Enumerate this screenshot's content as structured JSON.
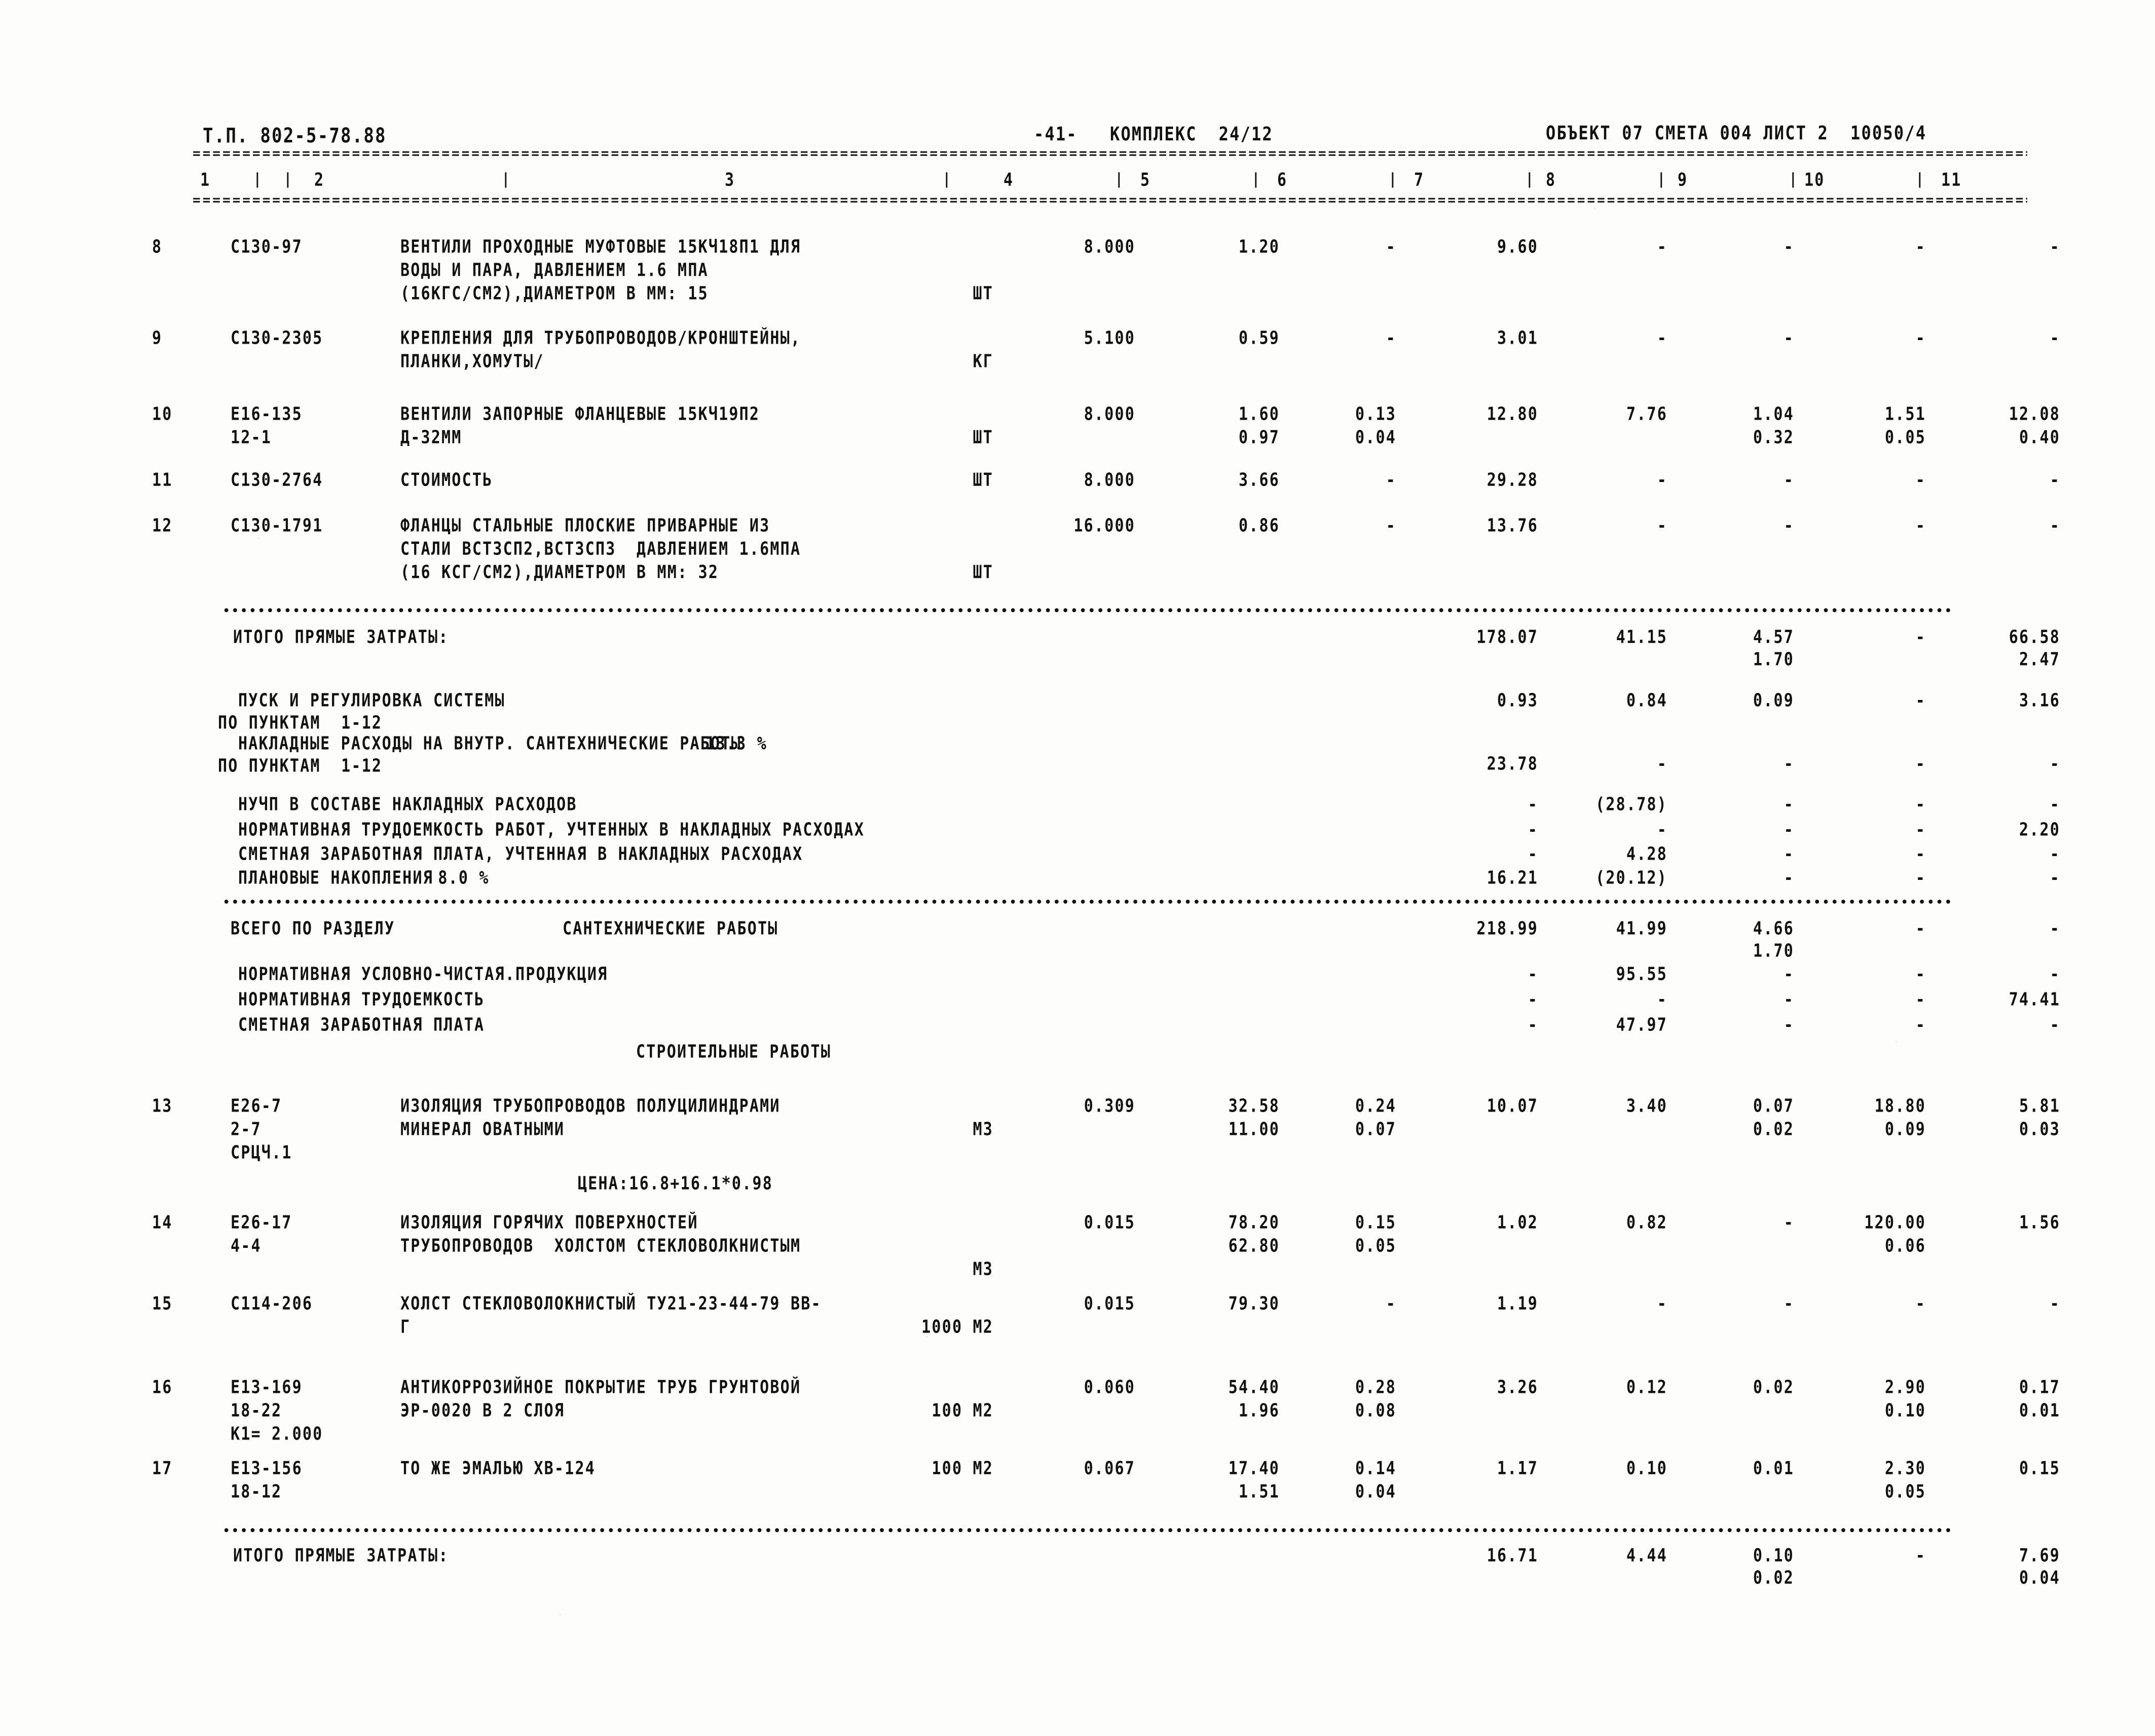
{
  "header": {
    "doc_code": "Т.П. 802-5-78.88",
    "page_number": "-41-",
    "complex_label": "КОМПЛЕКС",
    "complex_value": "24/12",
    "object_line": "ОБЪЕКТ 07 СМЕТА 004 ЛИСТ 2  10050/4"
  },
  "column_numbers": [
    "1",
    "2",
    "3",
    "4",
    "5",
    "6",
    "7",
    "8",
    "9",
    "10",
    "11"
  ],
  "separator_char": "=",
  "dot_char": "•",
  "rows": [
    {
      "no": "8",
      "code": [
        "С130-97"
      ],
      "desc": [
        "ВЕНТИЛИ ПРОХОДНЫЕ МУФТОВЫЕ 15КЧ18П1 ДЛЯ",
        "ВОДЫ И ПАРА, ДАВЛЕНИЕМ 1.6 МПА",
        "(16КГС/СМ2),ДИАМЕТРОМ В ММ: 15"
      ],
      "unit": "ШТ",
      "unit_line": 2,
      "c4": [
        "8.000"
      ],
      "c5": [
        "1.20"
      ],
      "c6": [
        "-"
      ],
      "c7": [
        "9.60"
      ],
      "c8": [
        "-"
      ],
      "c9": [
        "-"
      ],
      "c10": [
        "-"
      ],
      "c11": [
        "-"
      ]
    },
    {
      "no": "9",
      "code": [
        "С130-2305"
      ],
      "desc": [
        "КРЕПЛЕНИЯ ДЛЯ ТРУБОПРОВОДОВ/КРОНШТЕЙНЫ,",
        "ПЛАНКИ,ХОМУТЫ/"
      ],
      "unit": "КГ",
      "unit_line": 1,
      "c4": [
        "5.100"
      ],
      "c5": [
        "0.59"
      ],
      "c6": [
        "-"
      ],
      "c7": [
        "3.01"
      ],
      "c8": [
        "-"
      ],
      "c9": [
        "-"
      ],
      "c10": [
        "-"
      ],
      "c11": [
        "-"
      ]
    },
    {
      "no": "10",
      "code": [
        "Е16-135",
        "12-1"
      ],
      "desc": [
        "ВЕНТИЛИ ЗАПОРНЫЕ ФЛАНЦЕВЫЕ 15КЧ19П2",
        "Д-32ММ"
      ],
      "unit": "ШТ",
      "unit_line": 1,
      "c4": [
        "8.000"
      ],
      "c5": [
        "1.60",
        "0.97"
      ],
      "c6": [
        "0.13",
        "0.04"
      ],
      "c7": [
        "12.80"
      ],
      "c8": [
        "7.76"
      ],
      "c9": [
        "1.04",
        "0.32"
      ],
      "c10": [
        "1.51",
        "0.05"
      ],
      "c11": [
        "12.08",
        "0.40"
      ]
    },
    {
      "no": "11",
      "code": [
        "С130-2764"
      ],
      "desc": [
        "СТОИМОСТЬ"
      ],
      "unit": "ШТ",
      "unit_line": 0,
      "c4": [
        "8.000"
      ],
      "c5": [
        "3.66"
      ],
      "c6": [
        "-"
      ],
      "c7": [
        "29.28"
      ],
      "c8": [
        "-"
      ],
      "c9": [
        "-"
      ],
      "c10": [
        "-"
      ],
      "c11": [
        "-"
      ]
    },
    {
      "no": "12",
      "code": [
        "С130-1791"
      ],
      "desc": [
        "ФЛАНЦЫ СТАЛЬНЫЕ ПЛОСКИЕ ПРИВАРНЫЕ ИЗ",
        "СТАЛИ ВСТ3СП2,ВСТ3СП3  ДАВЛЕНИЕМ 1.6МПА",
        "(16 КСГ/СМ2),ДИАМЕТРОМ В ММ: 32"
      ],
      "unit": "ШТ",
      "unit_line": 2,
      "c4": [
        "16.000"
      ],
      "c5": [
        "0.86"
      ],
      "c6": [
        "-"
      ],
      "c7": [
        "13.76"
      ],
      "c8": [
        "-"
      ],
      "c9": [
        "-"
      ],
      "c10": [
        "-"
      ],
      "c11": [
        "-"
      ]
    }
  ],
  "subtotal_1": {
    "label": "ИТОГО ПРЯМЫЕ ЗАТРАТЫ:",
    "c7": [
      "178.07"
    ],
    "c8": [
      "41.15"
    ],
    "c9": [
      "4.57",
      "1.70"
    ],
    "c10": [
      "-"
    ],
    "c11": [
      "66.58",
      "2.47"
    ]
  },
  "overhead": [
    {
      "label": "ПУСК И РЕГУЛИРОВКА СИСТЕМЫ",
      "sub": "ПО ПУНКТАМ  1-12",
      "c7": "0.93",
      "c8": "0.84",
      "c9": "0.09",
      "c10": "-",
      "c11": "3.16"
    },
    {
      "label": "НАКЛАДНЫЕ РАСХОДЫ НА ВНУТР. САНТЕХНИЧЕСКИЕ РАБОТЫ",
      "percent": "13.3 %",
      "sub": "ПО ПУНКТАМ  1-12",
      "c7": "23.78",
      "c8": "-",
      "c9": "-",
      "c10": "-",
      "c11": "-"
    },
    {
      "label": "НУЧП В СОСТАВЕ НАКЛАДНЫХ РАСХОДОВ",
      "c7": "-",
      "c8": "(28.78)",
      "c9": "-",
      "c10": "-",
      "c11": "-"
    },
    {
      "label": "НОРМАТИВНАЯ ТРУДОЕМКОСТЬ РАБОТ, УЧТЕННЫХ В НАКЛАДНЫХ РАСХОДАХ",
      "c7": "-",
      "c8": "-",
      "c9": "-",
      "c10": "-",
      "c11": "2.20"
    },
    {
      "label": "СМЕТНАЯ ЗАРАБОТНАЯ ПЛАТА, УЧТЕННАЯ В НАКЛАДНЫХ РАСХОДАХ",
      "c7": "-",
      "c8": "4.28",
      "c9": "-",
      "c10": "-",
      "c11": "-"
    },
    {
      "label": "ПЛАНОВЫЕ НАКОПЛЕНИЯ",
      "percent": "8.0 %",
      "c7": "16.21",
      "c8": "(20.12)",
      "c9": "-",
      "c10": "-",
      "c11": "-"
    }
  ],
  "section_total": {
    "label": "ВСЕГО ПО РАЗДЕЛУ",
    "name": "САНТЕХНИЧЕСКИЕ РАБОТЫ",
    "c7": [
      "218.99"
    ],
    "c8": [
      "41.99"
    ],
    "c9": [
      "4.66",
      "1.70"
    ],
    "c10": [
      "-"
    ],
    "c11": [
      "-"
    ]
  },
  "section_extras": [
    {
      "label": "НОРМАТИВНАЯ УСЛОВНО-ЧИСТАЯ.ПРОДУКЦИЯ",
      "c7": "-",
      "c8": "95.55",
      "c9": "-",
      "c10": "-",
      "c11": "-"
    },
    {
      "label": "НОРМАТИВНАЯ ТРУДОЕМКОСТЬ",
      "c7": "-",
      "c8": "-",
      "c9": "-",
      "c10": "-",
      "c11": "74.41"
    },
    {
      "label": "СМЕТНАЯ ЗАРАБОТНАЯ ПЛАТА",
      "c7": "-",
      "c8": "47.97",
      "c9": "-",
      "c10": "-",
      "c11": "-"
    }
  ],
  "section_title_2": "СТРОИТЕЛЬНЫЕ РАБОТЫ",
  "rows2": [
    {
      "no": "13",
      "code": [
        "Е26-7",
        "2-7",
        "СРЦЧ.1"
      ],
      "desc": [
        "ИЗОЛЯЦИЯ ТРУБОПРОВОДОВ ПОЛУЦИЛИНДРАМИ",
        "МИНЕРАЛ ОВАТНЫМИ"
      ],
      "unit": "М3",
      "unit_line": 1,
      "c4": [
        "0.309"
      ],
      "c5": [
        "32.58",
        "11.00"
      ],
      "c6": [
        "0.24",
        "0.07"
      ],
      "c7": [
        "10.07"
      ],
      "c8": [
        "3.40"
      ],
      "c9": [
        "0.07",
        "0.02"
      ],
      "c10": [
        "18.80",
        "0.09"
      ],
      "c11": [
        "5.81",
        "0.03"
      ]
    },
    {
      "no": "14",
      "code": [
        "Е26-17",
        "4-4"
      ],
      "desc": [
        "ИЗОЛЯЦИЯ ГОРЯЧИХ ПОВЕРХНОСТЕЙ",
        "ТРУБОПРОВОДОВ  ХОЛСТОМ СТЕКЛОВОЛКНИСТЫМ"
      ],
      "unit": "М3",
      "unit_line": 2,
      "c4": [
        "0.015"
      ],
      "c5": [
        "78.20",
        "62.80"
      ],
      "c6": [
        "0.15",
        "0.05"
      ],
      "c7": [
        "1.02"
      ],
      "c8": [
        "0.82"
      ],
      "c9": [
        "-"
      ],
      "c10": [
        "120.00",
        "0.06"
      ],
      "c11": [
        "1.56"
      ]
    },
    {
      "no": "15",
      "code": [
        "С114-206"
      ],
      "desc": [
        "ХОЛСТ СТЕКЛОВОЛОКНИСТЫЙ ТУ21-23-44-79 ВВ-",
        "Г"
      ],
      "unit": "1000 М2",
      "unit_line": 1,
      "c4": [
        "0.015"
      ],
      "c5": [
        "79.30"
      ],
      "c6": [
        "-"
      ],
      "c7": [
        "1.19"
      ],
      "c8": [
        "-"
      ],
      "c9": [
        "-"
      ],
      "c10": [
        "-"
      ],
      "c11": [
        "-"
      ]
    },
    {
      "no": "16",
      "code": [
        "Е13-169",
        "18-22",
        "К1= 2.000"
      ],
      "desc": [
        "АНТИКОРРОЗИЙНОЕ ПОКРЫТИЕ ТРУБ ГРУНТОВОЙ",
        "ЭР-0020 В 2 СЛОЯ"
      ],
      "unit": "100 М2",
      "unit_line": 1,
      "c4": [
        "0.060"
      ],
      "c5": [
        "54.40",
        "1.96"
      ],
      "c6": [
        "0.28",
        "0.08"
      ],
      "c7": [
        "3.26"
      ],
      "c8": [
        "0.12"
      ],
      "c9": [
        "0.02"
      ],
      "c10": [
        "2.90",
        "0.10"
      ],
      "c11": [
        "0.17",
        "0.01"
      ]
    },
    {
      "no": "17",
      "code": [
        "Е13-156",
        "18-12"
      ],
      "desc": [
        "ТО ЖЕ ЭМАЛЬЮ ХВ-124"
      ],
      "unit": "100 М2",
      "unit_line": 0,
      "c4": [
        "0.067"
      ],
      "c5": [
        "17.40",
        "1.51"
      ],
      "c6": [
        "0.14",
        "0.04"
      ],
      "c7": [
        "1.17"
      ],
      "c8": [
        "0.10"
      ],
      "c9": [
        "0.01"
      ],
      "c10": [
        "2.30",
        "0.05"
      ],
      "c11": [
        "0.15"
      ]
    }
  ],
  "price_note": "ЦЕНА:16.8+16.1*0.98",
  "subtotal_2": {
    "label": "ИТОГО ПРЯМЫЕ ЗАТРАТЫ:",
    "c7": [
      "16.71"
    ],
    "c8": [
      "4.44"
    ],
    "c9": [
      "0.10",
      "0.02"
    ],
    "c10": [
      "-"
    ],
    "c11": [
      "7.69",
      "0.04"
    ]
  }
}
